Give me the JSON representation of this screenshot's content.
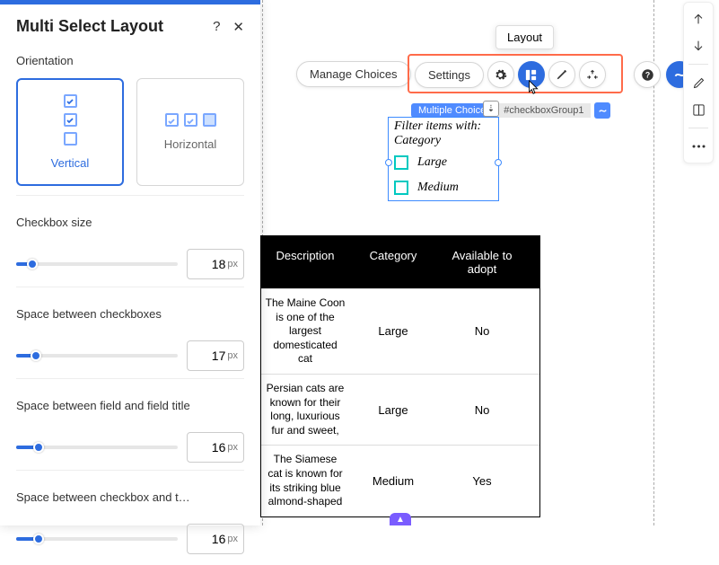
{
  "panel": {
    "title": "Multi Select Layout",
    "orientation_label": "Orientation",
    "vertical_label": "Vertical",
    "horizontal_label": "Horizontal",
    "sliders": [
      {
        "label": "Checkbox size",
        "value": "18",
        "unit": "px",
        "pct": 10
      },
      {
        "label": "Space between checkboxes",
        "value": "17",
        "unit": "px",
        "pct": 12
      },
      {
        "label": "Space between field and field title",
        "value": "16",
        "unit": "px",
        "pct": 14
      },
      {
        "label": "Space between checkbox and t…",
        "value": "16",
        "unit": "px",
        "pct": 14
      }
    ]
  },
  "toolbar": {
    "manage_choices": "Manage Choices",
    "settings": "Settings",
    "tooltip": "Layout"
  },
  "widget": {
    "badge_type": "Multiple Choice",
    "badge_id": "#checkboxGroup1",
    "title": "Filter items with: Category",
    "options": [
      "Large",
      "Medium"
    ]
  },
  "table": {
    "headers": [
      "Description",
      "Category",
      "Available to adopt"
    ],
    "rows": [
      {
        "desc": "The Maine Coon is one of the largest domesticated cat",
        "cat": "Large",
        "adopt": "No"
      },
      {
        "desc": "Persian cats are known for their long, luxurious fur and sweet,",
        "cat": "Large",
        "adopt": "No"
      },
      {
        "desc": "The Siamese cat is known for its striking blue almond-shaped",
        "cat": "Medium",
        "adopt": "Yes"
      }
    ]
  }
}
